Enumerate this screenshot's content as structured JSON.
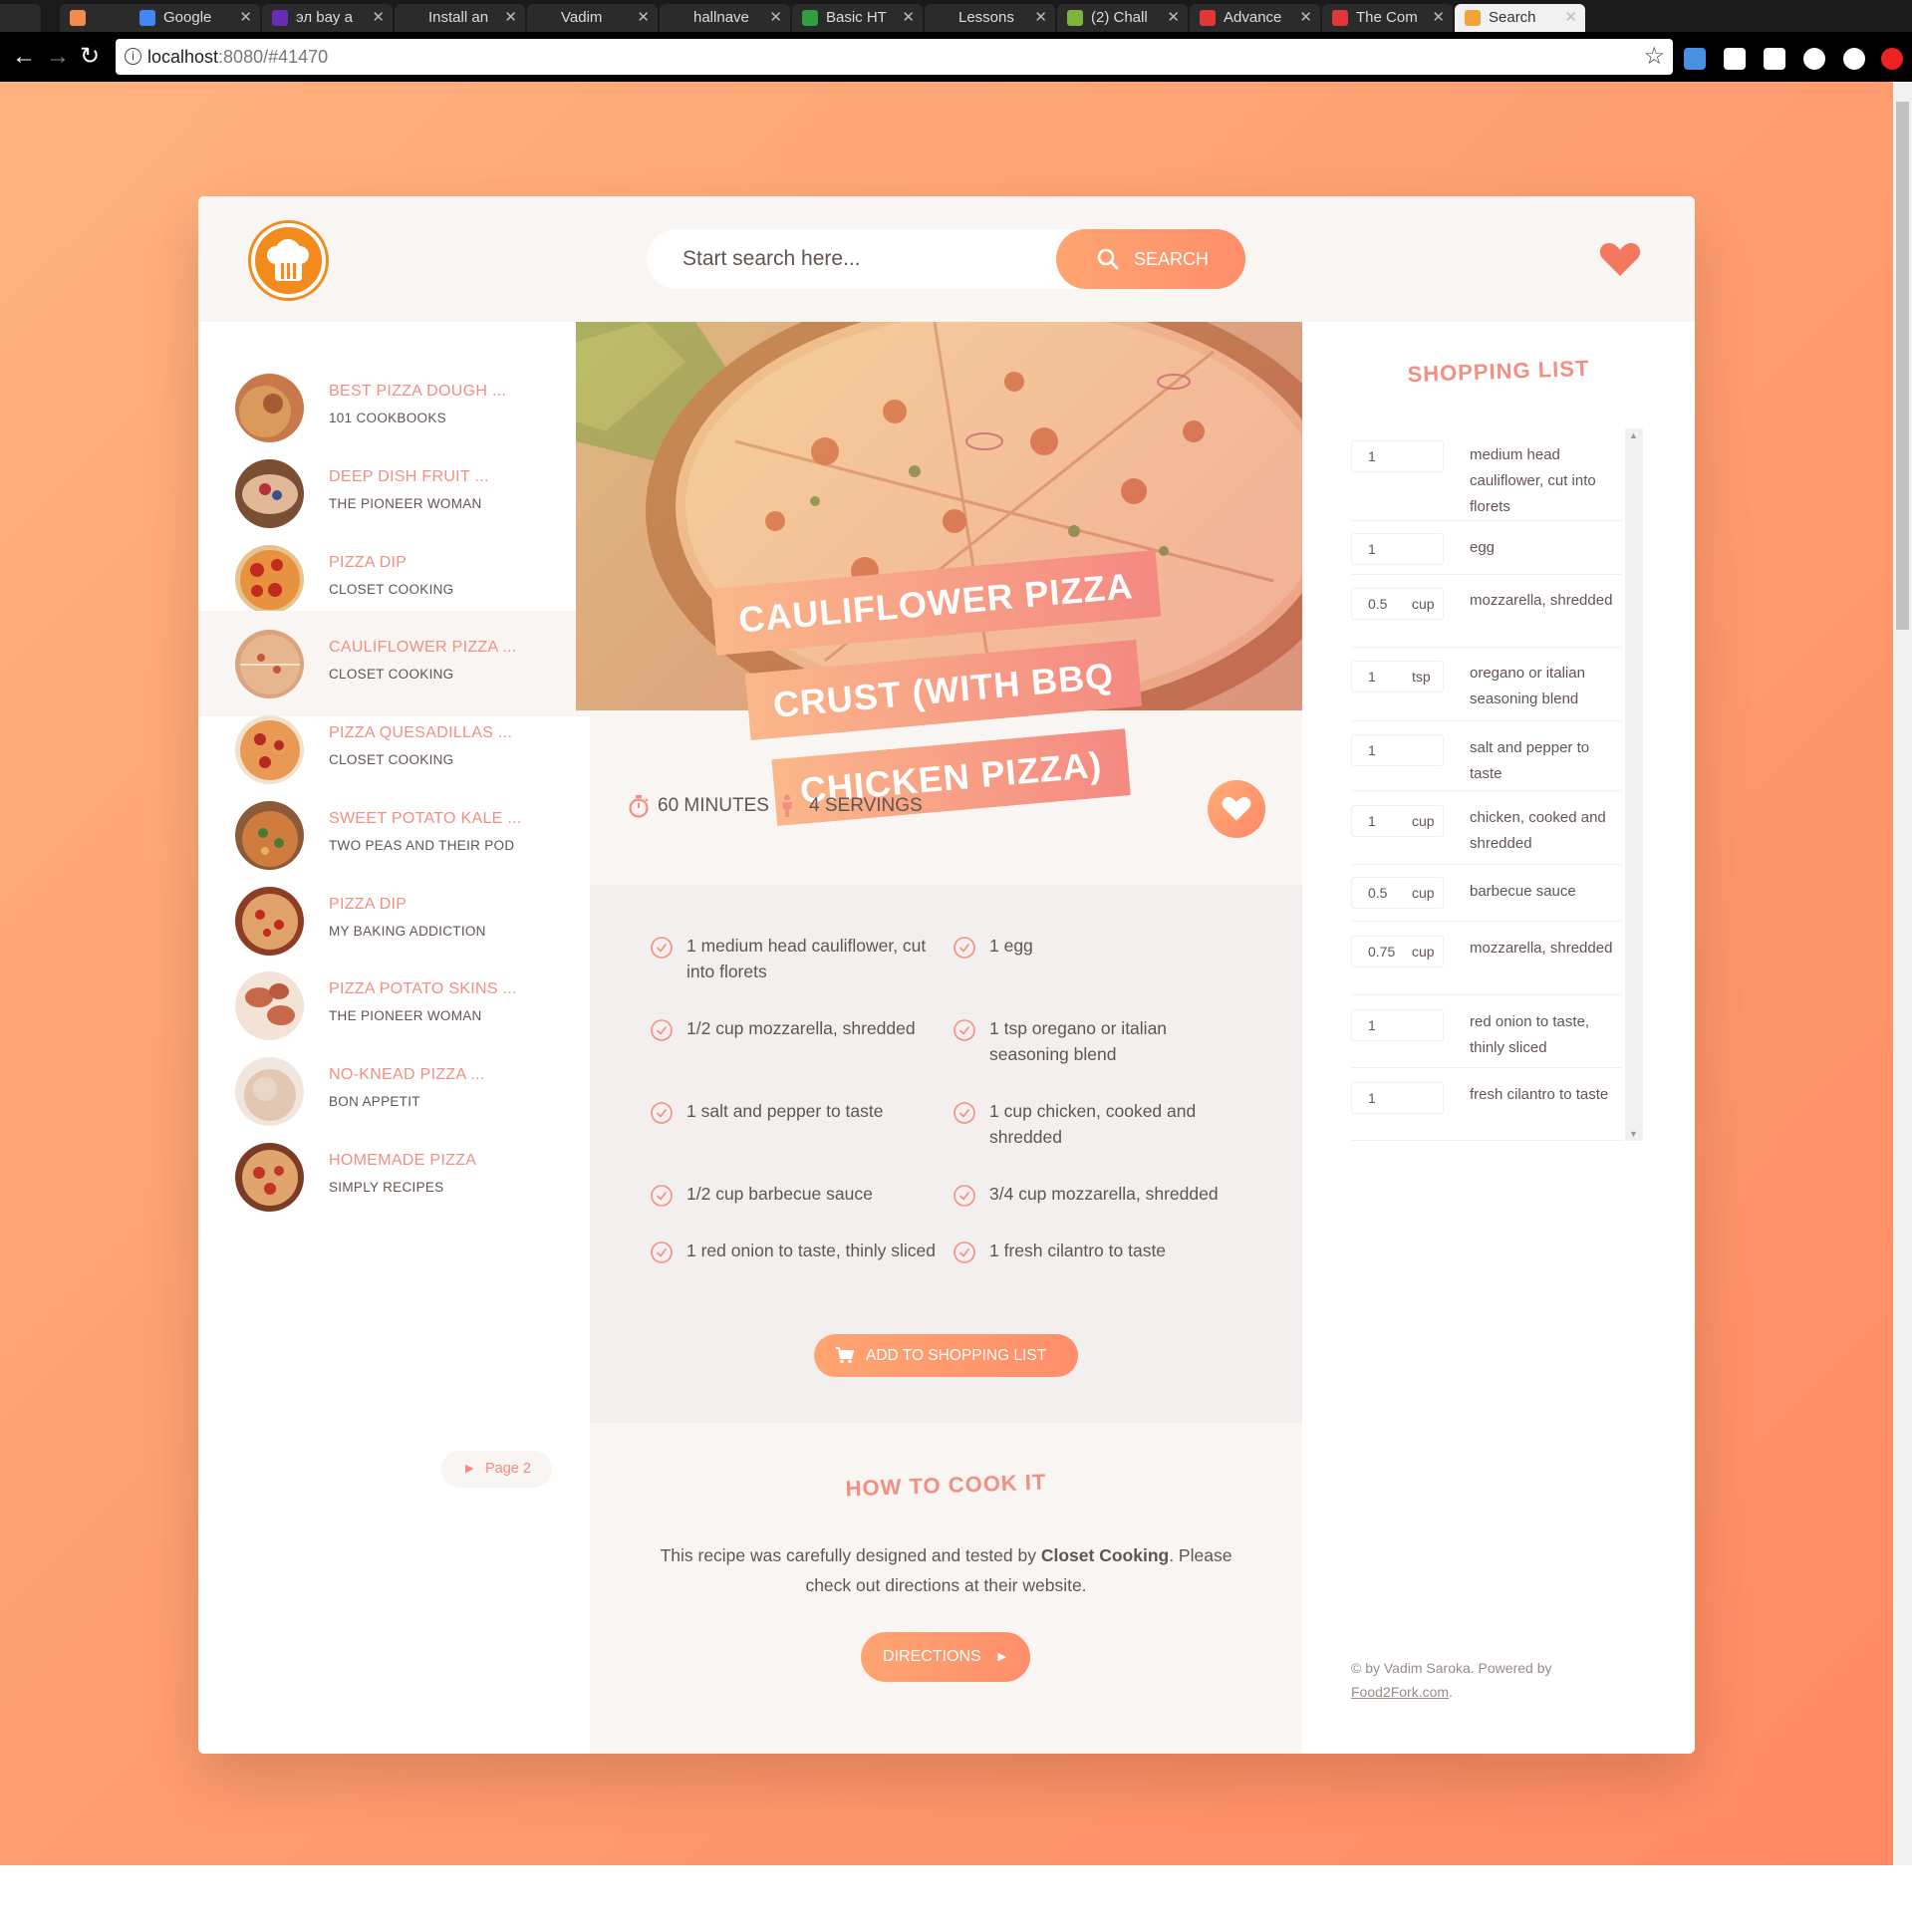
{
  "browser": {
    "tabs": [
      {
        "label": ""
      },
      {
        "label": "Google"
      },
      {
        "label": "эл бау ...",
        "short": "эл bay a"
      },
      {
        "label": "Install an"
      },
      {
        "label": "Vadim"
      },
      {
        "label": "hallnave"
      },
      {
        "label": "Basic HT"
      },
      {
        "label": "Lessons"
      },
      {
        "label": "(2) Chall"
      },
      {
        "label": "Advance"
      },
      {
        "label": "The Com"
      },
      {
        "label": "Search"
      }
    ],
    "url_host": "localhost",
    "url_rest": ":8080/#41470"
  },
  "header": {
    "search_placeholder": "Start search here...",
    "search_label": "SEARCH"
  },
  "results": [
    {
      "title": "BEST PIZZA DOUGH ...",
      "author": "101 COOKBOOKS"
    },
    {
      "title": "DEEP DISH FRUIT ...",
      "author": "THE PIONEER WOMAN"
    },
    {
      "title": "PIZZA DIP",
      "author": "CLOSET COOKING"
    },
    {
      "title": "CAULIFLOWER PIZZA ...",
      "author": "CLOSET COOKING"
    },
    {
      "title": "PIZZA QUESADILLAS ...",
      "author": "CLOSET COOKING"
    },
    {
      "title": "SWEET POTATO KALE ...",
      "author": "TWO PEAS AND THEIR POD"
    },
    {
      "title": "PIZZA DIP",
      "author": "MY BAKING ADDICTION"
    },
    {
      "title": "PIZZA POTATO SKINS ...",
      "author": "THE PIONEER WOMAN"
    },
    {
      "title": "NO-KNEAD PIZZA ...",
      "author": "BON APPETIT"
    },
    {
      "title": "HOMEMADE PIZZA",
      "author": "SIMPLY RECIPES"
    }
  ],
  "pagination": {
    "label": "Page 2"
  },
  "recipe": {
    "title": "CAULIFLOWER PIZZA CRUST (WITH BBQ CHICKEN PIZZA)",
    "minutes": "60 MINUTES",
    "servings": "4 SERVINGS",
    "ingredients": [
      "1 medium head cauliflower, cut into florets",
      "1 egg",
      "1/2 cup mozzarella, shredded",
      "1 tsp oregano or italian seasoning blend",
      "1 salt and pepper to taste",
      "1 cup chicken, cooked and shredded",
      "1/2 cup barbecue sauce",
      "3/4 cup mozzarella, shredded",
      "1 red onion to taste, thinly sliced",
      "1 fresh cilantro to taste"
    ],
    "add_button": "ADD TO SHOPPING LIST",
    "directions_title": "HOW TO COOK IT",
    "directions_text_1": "This recipe was carefully designed and tested by ",
    "directions_author": "Closet Cooking",
    "directions_text_2": ". Please check out directions at their website.",
    "directions_button": "DIRECTIONS"
  },
  "shopping": {
    "title": "SHOPPING LIST",
    "items": [
      {
        "count": "1",
        "unit": "",
        "desc": "medium head cauliflower, cut into florets"
      },
      {
        "count": "1",
        "unit": "",
        "desc": "egg"
      },
      {
        "count": "0.5",
        "unit": "cup",
        "desc": "mozzarella, shredded"
      },
      {
        "count": "1",
        "unit": "tsp",
        "desc": "oregano or italian seasoning blend"
      },
      {
        "count": "1",
        "unit": "",
        "desc": "salt and pepper to taste"
      },
      {
        "count": "1",
        "unit": "cup",
        "desc": "chicken, cooked and shredded"
      },
      {
        "count": "0.5",
        "unit": "cup",
        "desc": "barbecue sauce"
      },
      {
        "count": "0.75",
        "unit": "cup",
        "desc": "mozzarella, shredded"
      },
      {
        "count": "1",
        "unit": "",
        "desc": "red onion to taste, thinly sliced"
      },
      {
        "count": "1",
        "unit": "",
        "desc": "fresh cilantro to taste"
      }
    ],
    "copyright": "© by Vadim Saroka. Powered by",
    "powered_link": "Food2Fork.com",
    "copyright_end": "."
  },
  "colors": {
    "accent": "#f38e82",
    "text": "#615551",
    "bg_light": "#f9f5f3",
    "gradient_start": "#ffb27d",
    "gradient_end": "#ff8a63"
  }
}
